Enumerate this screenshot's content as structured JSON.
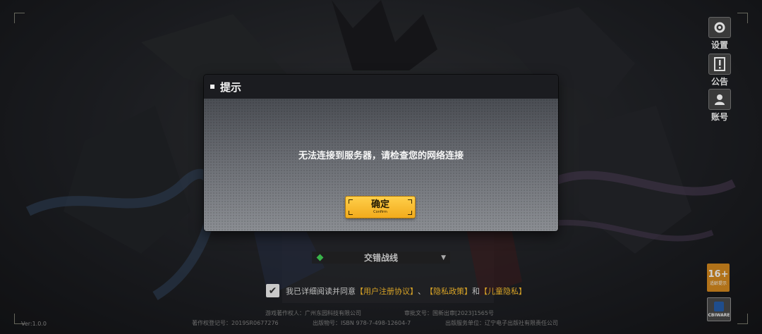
{
  "side_menu": {
    "settings": "设置",
    "notice": "公告",
    "account": "账号"
  },
  "dialog": {
    "title": "提示",
    "message": "无法连接到服务器，请检查您的网络连接",
    "confirm_label": "确定",
    "confirm_sub": "Confirm"
  },
  "server": {
    "name": "交错战线"
  },
  "agreement": {
    "prefix": "我已详细阅读并同意",
    "link1": "【用户注册协议】",
    "sep1": "、",
    "link2": "【隐私政策】",
    "sep2": "和",
    "link3": "【儿童隐私】",
    "checked": true
  },
  "legal": {
    "copyright_owner": "游戏著作权人：广州东园科技有限公司",
    "approval_no": "审批文号：国新出审[2023]1565号",
    "registration_no": "著作权登记号：2019SR0677276",
    "isbn": "出版物号：ISBN 978-7-498-12604-7",
    "publisher": "出版服务单位：辽宁电子出版社有限责任公司"
  },
  "version": "Ver:1.0.0",
  "age_badge": {
    "number": "16+",
    "text": "适龄提示"
  },
  "cbi_badge": {
    "text": "CBIWARE"
  }
}
